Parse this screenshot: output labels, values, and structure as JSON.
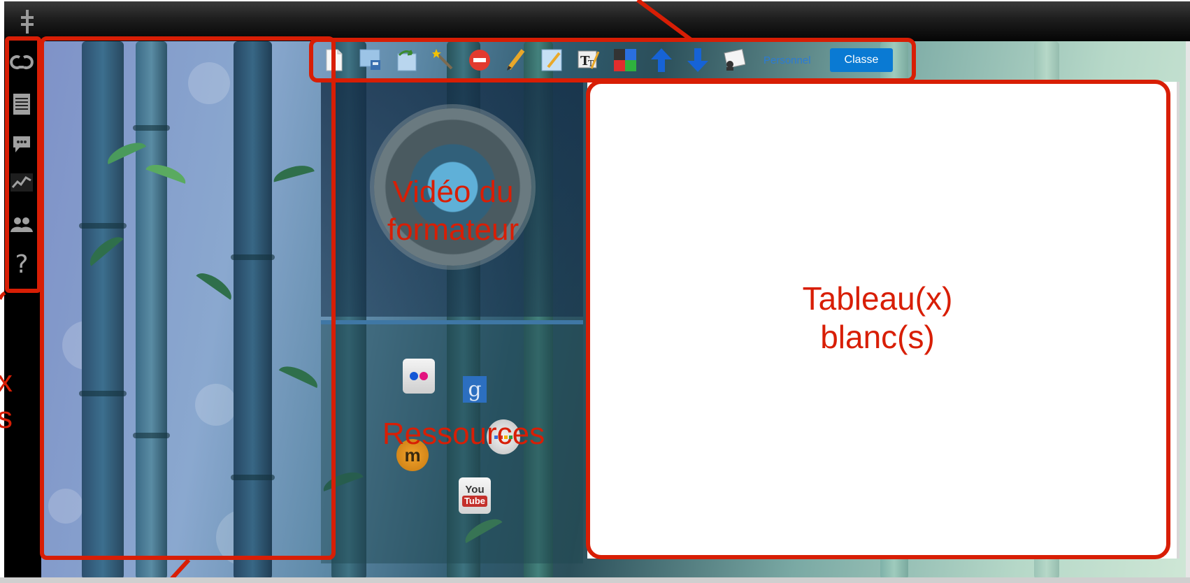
{
  "toolbar": {
    "tool_icons": [
      "page-icon",
      "save-icon",
      "redo-icon",
      "magic-wand-icon",
      "delete-icon",
      "pencil-icon",
      "highlighter-icon",
      "text-tool-icon",
      "color-palette-icon",
      "arrow-up-icon",
      "arrow-down-icon",
      "presenter-icon"
    ],
    "personnel_label": "Personnel",
    "classe_label": "Classe"
  },
  "sidebar": {
    "icons": [
      "link-icon",
      "notes-icon",
      "chat-icon",
      "stats-icon",
      "users-icon",
      "help-icon"
    ],
    "help_glyph": "?"
  },
  "annotations": {
    "video_label": "Vidéo du formateur",
    "resources_label": "Ressources",
    "whiteboard_label": "Tableau(x) blanc(s)",
    "left_cut_label": "x\ns"
  },
  "resources": {
    "icons": [
      "flickr-icon",
      "google-icon",
      "moodle-icon",
      "google-round-icon",
      "youtube-icon"
    ],
    "google_letter": "g",
    "moodle_letter": "m",
    "youtube_you": "You",
    "youtube_tube": "Tube"
  },
  "colors": {
    "annotation": "#d81e05",
    "classe_button": "#0a7ad3",
    "personnel_link": "#2a7bd6"
  }
}
